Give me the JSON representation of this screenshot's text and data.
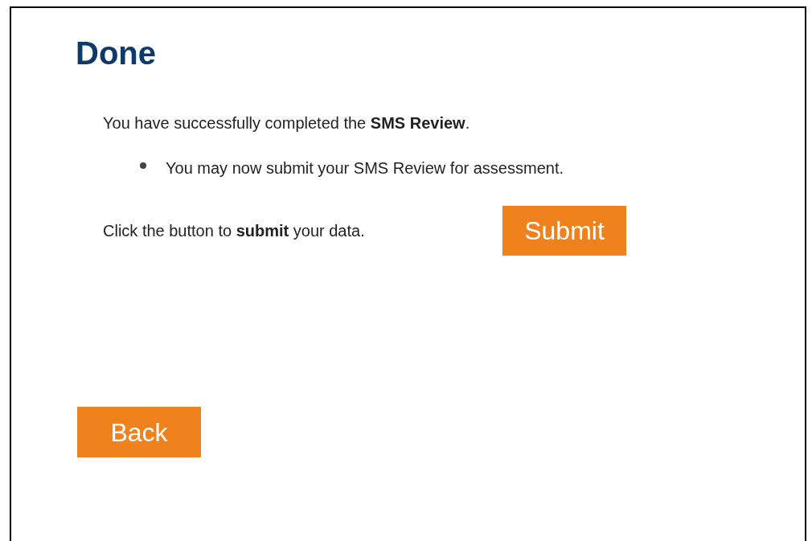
{
  "heading": "Done",
  "message": "You have successfully completed the **SMS Review**.",
  "bullets": [
    "You may now submit your SMS Review for assessment."
  ],
  "submit_prompt": "Click the button to **submit** your data.",
  "submit_button": "Submit",
  "back_button": "Back"
}
